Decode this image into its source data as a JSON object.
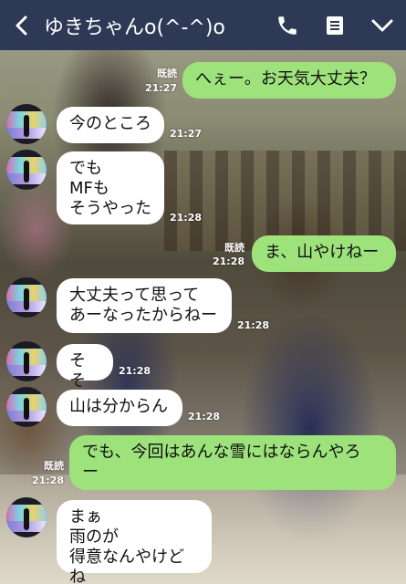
{
  "header": {
    "title": "ゆきちゃんo(^-^)o",
    "bg_color": "#2e3a55"
  },
  "messages": [
    {
      "side": "out",
      "text": "へぇー。お天気大丈夫？",
      "read": "既読",
      "time": "21:27"
    },
    {
      "side": "in",
      "text": "今のところ",
      "time": "21:27"
    },
    {
      "side": "in",
      "text": "でも\nMFも\nそうやった",
      "time": "21:28"
    },
    {
      "side": "out",
      "text": "ま、山やけねー",
      "read": "既読",
      "time": "21:28"
    },
    {
      "side": "in",
      "text": "大丈夫って思って\nあーなったからねー",
      "time": "21:28"
    },
    {
      "side": "in",
      "text": "そそ",
      "time": "21:28"
    },
    {
      "side": "in",
      "text": "山は分からん",
      "time": "21:28"
    },
    {
      "side": "out",
      "text": "でも、今回はあんな雪にはならんやろ\nー",
      "read": "既読",
      "time": "21:28"
    },
    {
      "side": "in",
      "text": "まぁ\n雨のが\n得意なんやけどね",
      "time": ""
    }
  ],
  "colors": {
    "outgoing_bubble": "#9ee27c",
    "incoming_bubble": "#ffffff"
  },
  "icons": [
    "back-arrow-icon",
    "phone-icon",
    "note-icon",
    "chevron-down-icon"
  ]
}
